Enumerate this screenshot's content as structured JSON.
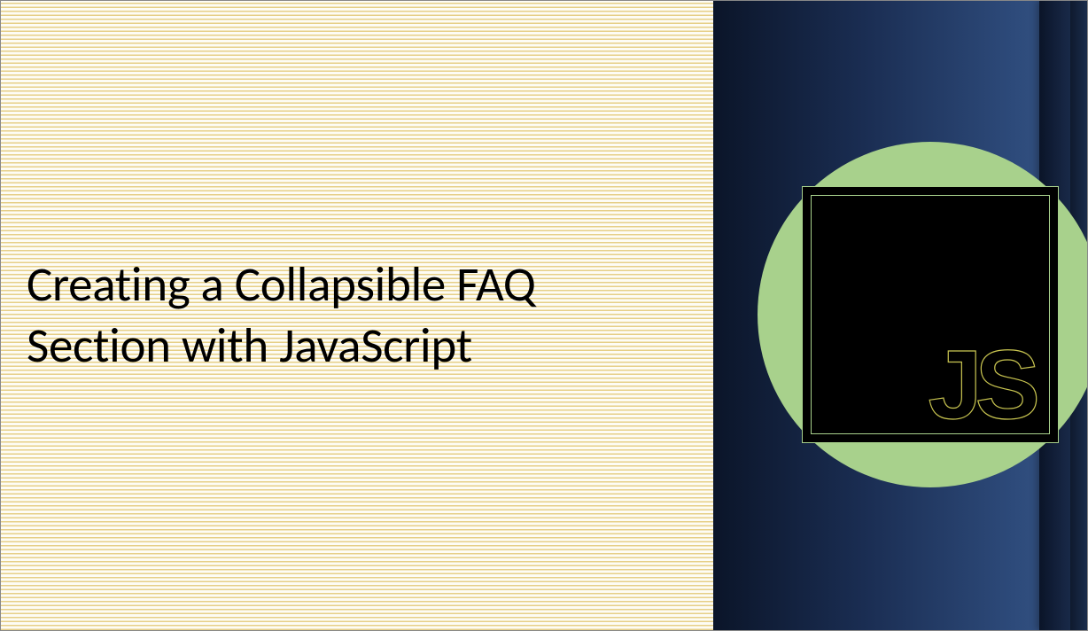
{
  "slide": {
    "title": "Creating a Collapsible FAQ Section with JavaScript",
    "logo": {
      "text_j": "J",
      "text_s": "S",
      "label": "JavaScript"
    }
  },
  "colors": {
    "leftBackground": "#fdfcf5",
    "stripeColor": "#e6cf87",
    "darkBlue": "#0b1529",
    "mediumBlue": "#2d4a7a",
    "circleGreen": "#a8d18c",
    "squareBlack": "#000000",
    "jsOutline": "#c8c450"
  }
}
